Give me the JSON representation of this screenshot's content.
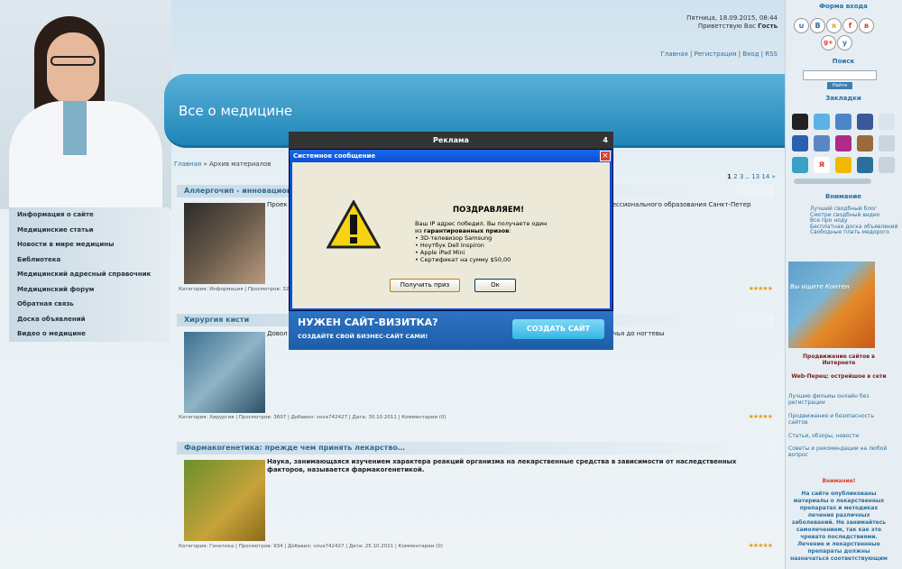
{
  "header": {
    "date": "Пятница, 18.09.2015, 08:44",
    "greeting_prefix": "Приветствую Вас",
    "greeting_name": "Гость",
    "links": [
      "Главная",
      "Регистрация",
      "Вход",
      "RSS"
    ],
    "site_title": "Все о медицине"
  },
  "breadcrumb": {
    "home": "Главная",
    "sep": "»",
    "current": "Архив материалов"
  },
  "pager": {
    "pages": [
      "1",
      "2",
      "3",
      "..",
      "13",
      "14",
      "»"
    ]
  },
  "menu": {
    "items": [
      {
        "label": "Информация о сайте"
      },
      {
        "label": "Медицинские статьи"
      },
      {
        "label": "Новости в мире медицины"
      },
      {
        "label": "Библиотека"
      },
      {
        "label": "Медицинский адресный справочник"
      },
      {
        "label": "Медицинский форум"
      },
      {
        "label": "Обратная связь"
      },
      {
        "label": "Доска объявлений"
      },
      {
        "label": "Видео о медицине"
      }
    ]
  },
  "entries": [
    {
      "title": "Аллергочип - инновацион",
      "text": "Проек ... стемы в формате микрочипа для прове ... класса E  в сыворотке крови человека» - стал п ... фессионального образования Санкт-Петер",
      "meta": "Категория: Информация | Просмотров: 3273"
    },
    {
      "title": "Хирургия кисти",
      "text": "Довол ... проблемами занимается хирургия кисти. В частно ... жены от средней трети вашего предплечья до ногтевы",
      "meta": "Категория: Хирургия | Просмотров: 3607 | Добавил: vova742427 | Дата: 30.10.2011 | Комментарии (0)"
    },
    {
      "title": "Фармакогенетика: прежде чем принять лекарство…",
      "text": "Наука, занимающаяся изучением характера реакций организма на лекарственные средства в зависимости от наследственных факторов, называется фармакогенетикой.",
      "meta": "Категория: Генетика | Просмотров: 934 | Добавил: vova742427 | Дата: 25.10.2011 | Комментарии (0)"
    }
  ],
  "rating_stars": "★★★★★",
  "sidebar": {
    "login_title": "Форма входа",
    "social": [
      "u",
      "B",
      "я",
      "f",
      "в",
      "g+",
      "y"
    ],
    "search_title": "Поиск",
    "search_button": "Найти",
    "bookmarks_title": "Закладки",
    "attention_title": "Внимание",
    "attention_links": [
      "Лучший сводбный блог",
      "Смотри сводбный видео",
      "Все про ноду",
      "Бесплатная доска объявлений",
      "Свободные плать медорого"
    ],
    "ad_image_text": "Вы ищите Контен",
    "promo_label": "Продвижение сайтов в Интернете",
    "webpepper_label": "Web-Перец: острейшое в сети",
    "links": [
      "Лучшие фильмы онлайн без регистрации",
      "Продвижение и безопасность сайтов",
      "Статьи, обзоры, новости",
      "Советы и рекомендации на любой вопрос"
    ],
    "warning_title": "Внимание!",
    "warning_text": "На сайте опубликованы материалы о лекарственных препаратах и методиках лечения различных заболеваний. Не занимайтесь самолечением, так как это чревато последствиями. Лечение и лекарственные препараты должны назначаться соответствующим"
  },
  "ad_overlay": {
    "title": "Реклама",
    "counter": "4"
  },
  "dialog": {
    "title": "Системное сообщение",
    "close": "×",
    "heading": "ПОЗДРАВЛЯЕМ!",
    "line1": "Ваш IP адрес победил. Вы получаете один",
    "line2_prefix": "из",
    "line2_bold": "гарантированных призов",
    "prizes": [
      "3D-телевизор Samsung",
      "Ноутбук Dell Inspiron",
      "Apple iPad Mini",
      "Сертификат на сумму $50,00"
    ],
    "btn_get": "Получить приз",
    "btn_ok": "Ок"
  },
  "promo": {
    "heading": "НУЖЕН САЙТ-ВИЗИТКА?",
    "sub": "СОЗДАЙТЕ СВОЙ БИЗНЕС-САЙТ САМИ!",
    "button": "СОЗДАТЬ САЙТ"
  }
}
